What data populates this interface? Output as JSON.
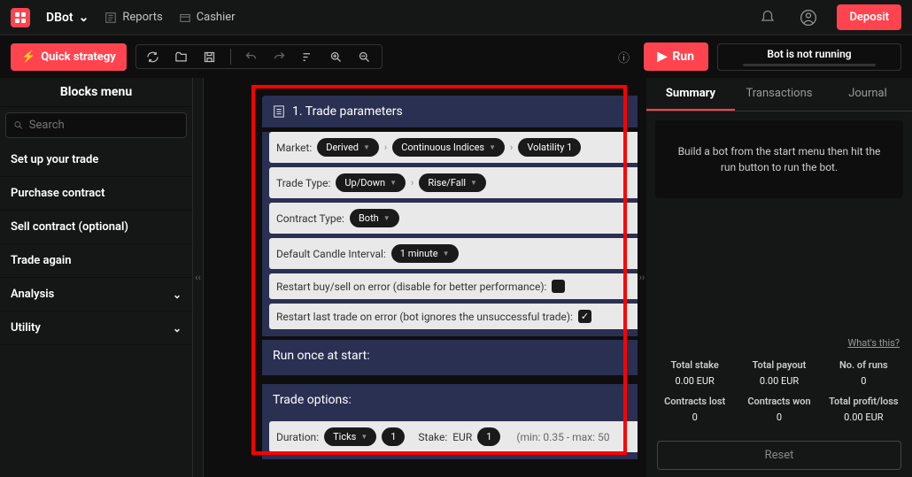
{
  "header": {
    "app": "DBot",
    "nav": [
      "Reports",
      "Cashier"
    ],
    "deposit": "Deposit"
  },
  "toolbar": {
    "quick_strategy": "Quick strategy",
    "run": "Run",
    "status": "Bot is not running"
  },
  "sidebar": {
    "title": "Blocks menu",
    "search_placeholder": "Search",
    "items": [
      "Set up your trade",
      "Purchase contract",
      "Sell contract (optional)",
      "Trade again",
      "Analysis",
      "Utility"
    ]
  },
  "block": {
    "title": "1. Trade parameters",
    "market_label": "Market:",
    "market": [
      "Derived",
      "Continuous Indices",
      "Volatility 1"
    ],
    "trade_type_label": "Trade Type:",
    "trade_type": [
      "Up/Down",
      "Rise/Fall"
    ],
    "contract_label": "Contract Type:",
    "contract": "Both",
    "candle_label": "Default Candle Interval:",
    "candle": "1 minute",
    "restart_buy": "Restart buy/sell on error (disable for better performance):",
    "restart_last": "Restart last trade on error (bot ignores the unsuccessful trade):",
    "run_once": "Run once at start:",
    "trade_options": "Trade options:",
    "duration_label": "Duration:",
    "duration_unit": "Ticks",
    "duration_val": "1",
    "stake_label": "Stake:",
    "stake_cur": "EUR",
    "stake_val": "1",
    "minmax": "(min: 0.35 - max: 50"
  },
  "right": {
    "tabs": [
      "Summary",
      "Transactions",
      "Journal"
    ],
    "hint": "Build a bot from the start menu then hit the run button to run the bot.",
    "whats_this": "What's this?",
    "stats": [
      {
        "lbl": "Total stake",
        "val": "0.00 EUR"
      },
      {
        "lbl": "Total payout",
        "val": "0.00 EUR"
      },
      {
        "lbl": "No. of runs",
        "val": "0"
      },
      {
        "lbl": "Contracts lost",
        "val": "0"
      },
      {
        "lbl": "Contracts won",
        "val": "0"
      },
      {
        "lbl": "Total profit/loss",
        "val": "0.00 EUR"
      }
    ],
    "reset": "Reset"
  }
}
